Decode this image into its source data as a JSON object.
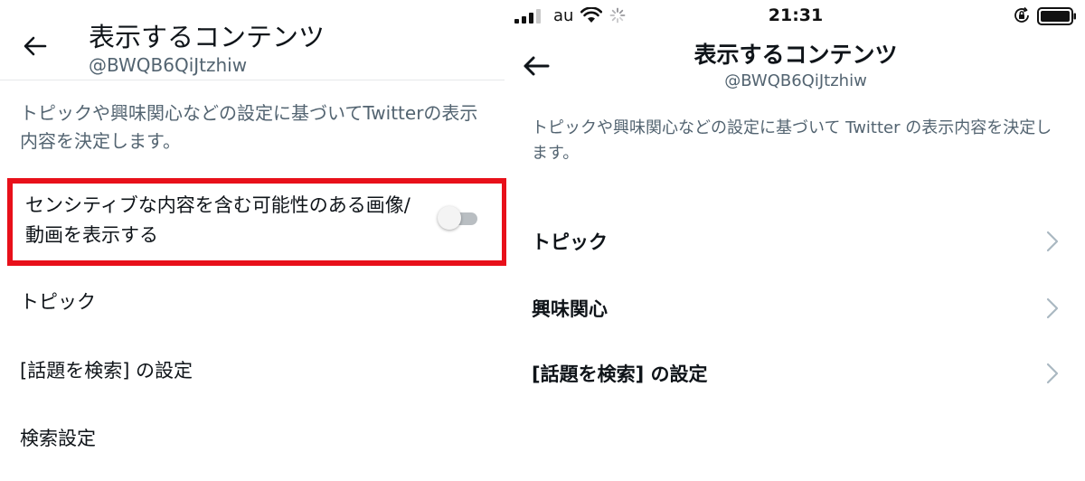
{
  "left": {
    "title": "表示するコンテンツ",
    "handle": "@BWQB6QiJtzhiw",
    "description": "トピックや興味関心などの設定に基づいてTwitterの表示内容を決定します。",
    "sensitive": {
      "label": "センシティブな内容を含む可能性のある画像/動画を表示する",
      "enabled": false
    },
    "items": [
      {
        "label": "トピック"
      },
      {
        "label": "[話題を検索] の設定"
      },
      {
        "label": "検索設定"
      }
    ],
    "highlight_color": "#e8101a"
  },
  "right": {
    "status": {
      "carrier": "au",
      "time": "21:31"
    },
    "title": "表示するコンテンツ",
    "handle": "@BWQB6QiJtzhiw",
    "description": "トピックや興味関心などの設定に基づいて Twitter の表示内容を決定します。",
    "items": [
      {
        "label": "トピック",
        "icon": "chevron-right-icon"
      },
      {
        "label": "興味関心",
        "icon": "chevron-right-icon"
      },
      {
        "label": "[話題を検索] の設定",
        "icon": "chevron-right-icon"
      }
    ]
  }
}
